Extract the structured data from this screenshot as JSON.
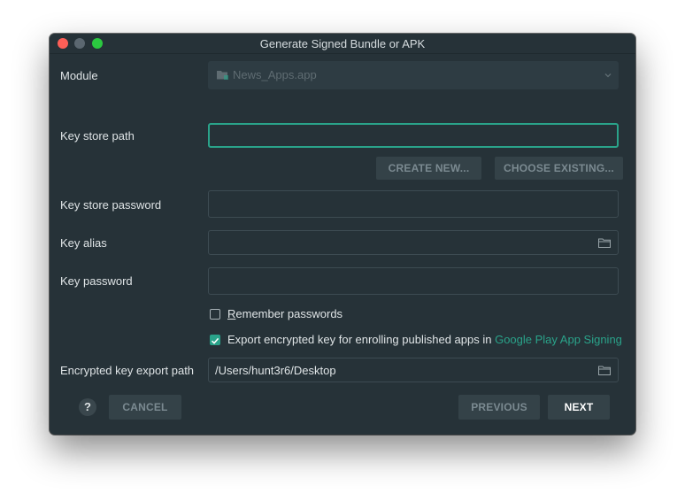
{
  "window": {
    "title": "Generate Signed Bundle or APK"
  },
  "module": {
    "label": "Module",
    "value": "News_Apps.app"
  },
  "keystore": {
    "path_label": "Key store path",
    "path_value": "",
    "create_new": "CREATE NEW...",
    "choose_existing": "CHOOSE EXISTING...",
    "password_label": "Key store password",
    "password_value": ""
  },
  "key": {
    "alias_label": "Key alias",
    "alias_value": "",
    "password_label": "Key password",
    "password_value": ""
  },
  "options": {
    "remember_prefix": "R",
    "remember_rest": "emember passwords",
    "remember_checked": false,
    "export_text": "Export encrypted key for enrolling published apps in ",
    "export_link": "Google Play App Signing",
    "export_checked": true
  },
  "export_path": {
    "label": "Encrypted key export path",
    "value": "/Users/hunt3r6/Desktop"
  },
  "footer": {
    "help": "?",
    "cancel": "CANCEL",
    "previous": "PREVIOUS",
    "next": "NEXT"
  },
  "colors": {
    "accent": "#2aa38a",
    "background": "#263238",
    "close": "#fe5f57",
    "maximize": "#2bc840"
  },
  "icons": [
    "close-icon",
    "minimize-icon",
    "maximize-icon",
    "module-icon",
    "chevron-down-icon",
    "folder-icon",
    "checkmark-icon",
    "help-icon"
  ]
}
